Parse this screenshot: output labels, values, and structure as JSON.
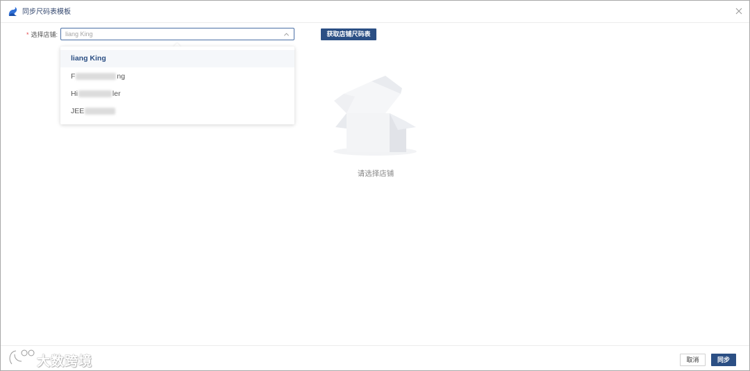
{
  "window": {
    "title": "同步尺码表模板",
    "logo_icon": "swan-logo-icon",
    "close_icon": "close-icon"
  },
  "form": {
    "required_mark": "*",
    "store_label": "选择店铺:",
    "store_select": {
      "value": "liang King",
      "arrow_icon": "chevron-up-icon",
      "open": true
    },
    "fetch_button": "获取店铺尺码表"
  },
  "dropdown": {
    "options": [
      {
        "visible_start": "liang King",
        "visible_end": "",
        "redacted": false,
        "selected": true
      },
      {
        "visible_start": "F",
        "visible_end": "ng",
        "redacted": true,
        "selected": false
      },
      {
        "visible_start": "Hi",
        "visible_end": "ler",
        "redacted": true,
        "selected": false
      },
      {
        "visible_start": "JEE",
        "visible_end": "",
        "redacted": true,
        "selected": false
      }
    ]
  },
  "empty_state": {
    "icon": "empty-box-icon",
    "text": "请选择店铺"
  },
  "footer": {
    "watermark_text": "大数跨境",
    "watermark_icon": "logo-watermark-icon",
    "cancel_button": "取消",
    "sync_button": "同步"
  },
  "colors": {
    "primary": "#2b4f84",
    "title_text": "#33476e",
    "required": "#e5484d",
    "selected_row_bg": "#f5f7fa"
  }
}
